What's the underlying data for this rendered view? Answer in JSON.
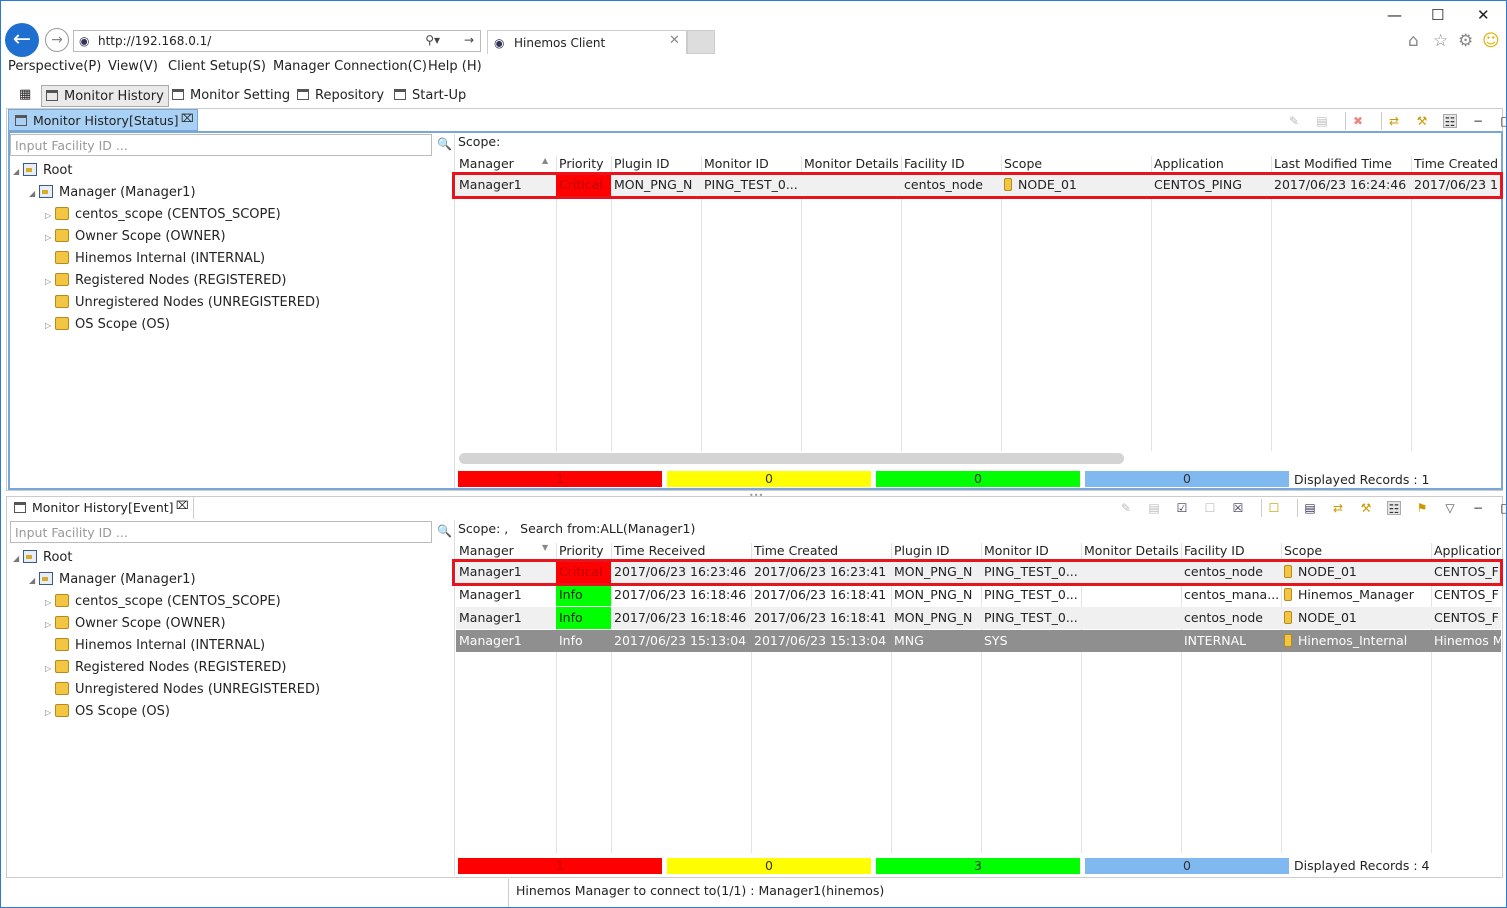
{
  "browser": {
    "url": "http://192.168.0.1/",
    "tab_title": "Hinemos Client"
  },
  "menu": [
    "Perspective(P)",
    "View(V)",
    "Client Setup(S)",
    "Manager Connection(C)",
    "Help (H)"
  ],
  "perspectives": [
    "Monitor History",
    "Monitor Setting",
    "Repository",
    "Start-Up"
  ],
  "status_view": {
    "title": "Monitor History[Status]",
    "facility_placeholder": "Input Facility ID ...",
    "scope_label": "Scope:",
    "tree": [
      {
        "label": "Root",
        "level": 0,
        "kind": "root",
        "expanded": true
      },
      {
        "label": "Manager (Manager1)",
        "level": 1,
        "kind": "manager",
        "expanded": true
      },
      {
        "label": "centos_scope (CENTOS_SCOPE)",
        "level": 2,
        "kind": "folder",
        "arrow": true
      },
      {
        "label": "Owner Scope (OWNER)",
        "level": 2,
        "kind": "folder",
        "arrow": true
      },
      {
        "label": "Hinemos Internal (INTERNAL)",
        "level": 2,
        "kind": "folder",
        "arrow": false
      },
      {
        "label": "Registered Nodes (REGISTERED)",
        "level": 2,
        "kind": "folder",
        "arrow": true
      },
      {
        "label": "Unregistered Nodes (UNREGISTERED)",
        "level": 2,
        "kind": "folder",
        "arrow": false
      },
      {
        "label": "OS Scope (OS)",
        "level": 2,
        "kind": "folder",
        "arrow": true
      }
    ],
    "columns": [
      "Manager",
      "Priority",
      "Plugin ID",
      "Monitor ID",
      "Monitor Details",
      "Facility ID",
      "Scope",
      "Application",
      "Last Modified Time",
      "Time Created"
    ],
    "rows": [
      [
        "Manager1",
        "Critical",
        "MON_PNG_N",
        "PING_TEST_0...",
        "",
        "centos_node",
        "NODE_01",
        "CENTOS_PING",
        "2017/06/23 16:24:46",
        "2017/06/23 1"
      ]
    ],
    "counts": [
      "1",
      "0",
      "0",
      "0"
    ],
    "displayed": "Displayed Records : 1"
  },
  "event_view": {
    "title": "Monitor History[Event]",
    "facility_placeholder": "Input Facility ID ...",
    "scope_label": "Scope: ,   Search from:ALL(Manager1)",
    "tree": [
      {
        "label": "Root",
        "level": 0,
        "kind": "root",
        "expanded": true
      },
      {
        "label": "Manager (Manager1)",
        "level": 1,
        "kind": "manager",
        "expanded": true
      },
      {
        "label": "centos_scope (CENTOS_SCOPE)",
        "level": 2,
        "kind": "folder",
        "arrow": true
      },
      {
        "label": "Owner Scope (OWNER)",
        "level": 2,
        "kind": "folder",
        "arrow": true
      },
      {
        "label": "Hinemos Internal (INTERNAL)",
        "level": 2,
        "kind": "folder",
        "arrow": false
      },
      {
        "label": "Registered Nodes (REGISTERED)",
        "level": 2,
        "kind": "folder",
        "arrow": true
      },
      {
        "label": "Unregistered Nodes (UNREGISTERED)",
        "level": 2,
        "kind": "folder",
        "arrow": false
      },
      {
        "label": "OS Scope (OS)",
        "level": 2,
        "kind": "folder",
        "arrow": true
      }
    ],
    "columns": [
      "Manager",
      "Priority",
      "Time Received",
      "Time Created",
      "Plugin ID",
      "Monitor ID",
      "Monitor Details",
      "Facility ID",
      "Scope",
      "Applicatior"
    ],
    "rows": [
      [
        "Manager1",
        "Critical",
        "2017/06/23 16:23:46",
        "2017/06/23 16:23:41",
        "MON_PNG_N",
        "PING_TEST_0...",
        "",
        "centos_node",
        "NODE_01",
        "CENTOS_F"
      ],
      [
        "Manager1",
        "Info",
        "2017/06/23 16:18:46",
        "2017/06/23 16:18:41",
        "MON_PNG_N",
        "PING_TEST_0...",
        "",
        "centos_mana...",
        "Hinemos_Manager",
        "CENTOS_F"
      ],
      [
        "Manager1",
        "Info",
        "2017/06/23 16:18:46",
        "2017/06/23 16:18:41",
        "MON_PNG_N",
        "PING_TEST_0...",
        "",
        "centos_node",
        "NODE_01",
        "CENTOS_F"
      ],
      [
        "Manager1",
        "Info",
        "2017/06/23 15:13:04",
        "2017/06/23 15:13:04",
        "MNG",
        "SYS",
        "",
        "INTERNAL",
        "Hinemos_Internal",
        "Hinemos M"
      ]
    ],
    "counts": [
      "1",
      "0",
      "3",
      "0"
    ],
    "displayed": "Displayed Records : 4"
  },
  "statusbar": "Hinemos Manager to connect to(1/1) : Manager1(hinemos)",
  "colors": {
    "critical": "#ff0000",
    "warning": "#ffff00",
    "info": "#00ff00",
    "unknown": "#80b9f0",
    "highlight": "#e8141d"
  }
}
